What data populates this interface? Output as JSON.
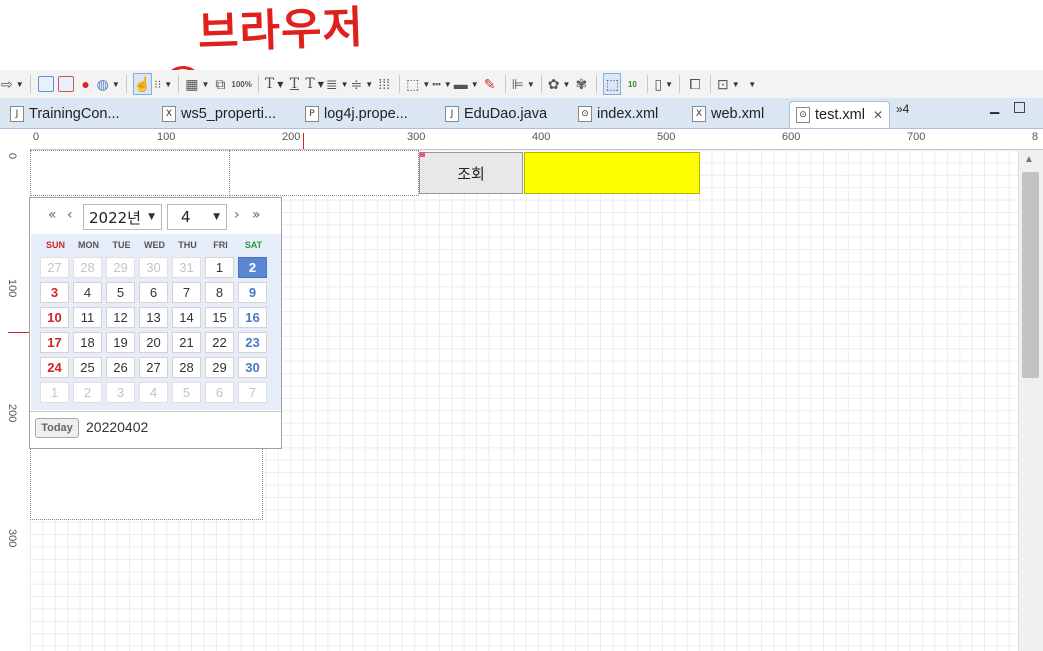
{
  "annotation": {
    "text": "브라우저"
  },
  "toolbar": {
    "icons": [
      "forward-arrow-icon",
      "new-window-icon",
      "run-window-icon",
      "stop-icon",
      "globe-icon",
      "hand-pointer-icon",
      "grid-select-icon",
      "layout-icon",
      "layer-icon",
      "zoom-100-icon",
      "text-t1-icon",
      "text-t2-icon",
      "text-t3-icon",
      "align-icon",
      "align-center-icon",
      "grid-icon",
      "box-icon",
      "line-icon",
      "line-thick-icon",
      "paint-icon",
      "align-left-icon",
      "palette-icon",
      "palette2-icon",
      "select-dotted-icon",
      "check-10-icon",
      "phone-icon",
      "window-icon",
      "window-check-icon"
    ],
    "zoom_badge": "100%",
    "check_badge": "10"
  },
  "tabs": [
    {
      "label": "TrainingCon...",
      "icon": "J"
    },
    {
      "label": "ws5_properti...",
      "icon": "X"
    },
    {
      "label": "log4j.prope...",
      "icon": "P"
    },
    {
      "label": "EduDao.java",
      "icon": "J"
    },
    {
      "label": "index.xml",
      "icon": "⊙"
    },
    {
      "label": "web.xml",
      "icon": "X"
    },
    {
      "label": "test.xml",
      "icon": "⊙",
      "active": true
    }
  ],
  "tab_overflow": "»4",
  "ruler": {
    "top": [
      "0",
      "100",
      "200",
      "300",
      "400",
      "500",
      "600",
      "700",
      "8"
    ],
    "left": [
      "0",
      "100",
      "200",
      "300"
    ]
  },
  "canvas": {
    "query_button": "조회"
  },
  "calendar": {
    "year": "2022년",
    "month": "4",
    "nav": {
      "first": "«",
      "prev": "‹",
      "next": "›",
      "last": "»"
    },
    "weekdays": [
      "SUN",
      "MON",
      "TUE",
      "WED",
      "THU",
      "FRI",
      "SAT"
    ],
    "weeks": [
      [
        "27",
        "28",
        "29",
        "30",
        "31",
        "1",
        "2"
      ],
      [
        "3",
        "4",
        "5",
        "6",
        "7",
        "8",
        "9"
      ],
      [
        "10",
        "11",
        "12",
        "13",
        "14",
        "15",
        "16"
      ],
      [
        "17",
        "18",
        "19",
        "20",
        "21",
        "22",
        "23"
      ],
      [
        "24",
        "25",
        "26",
        "27",
        "28",
        "29",
        "30"
      ],
      [
        "1",
        "2",
        "3",
        "4",
        "5",
        "6",
        "7"
      ]
    ],
    "selected": "2",
    "today_label": "Today",
    "value": "20220402"
  }
}
